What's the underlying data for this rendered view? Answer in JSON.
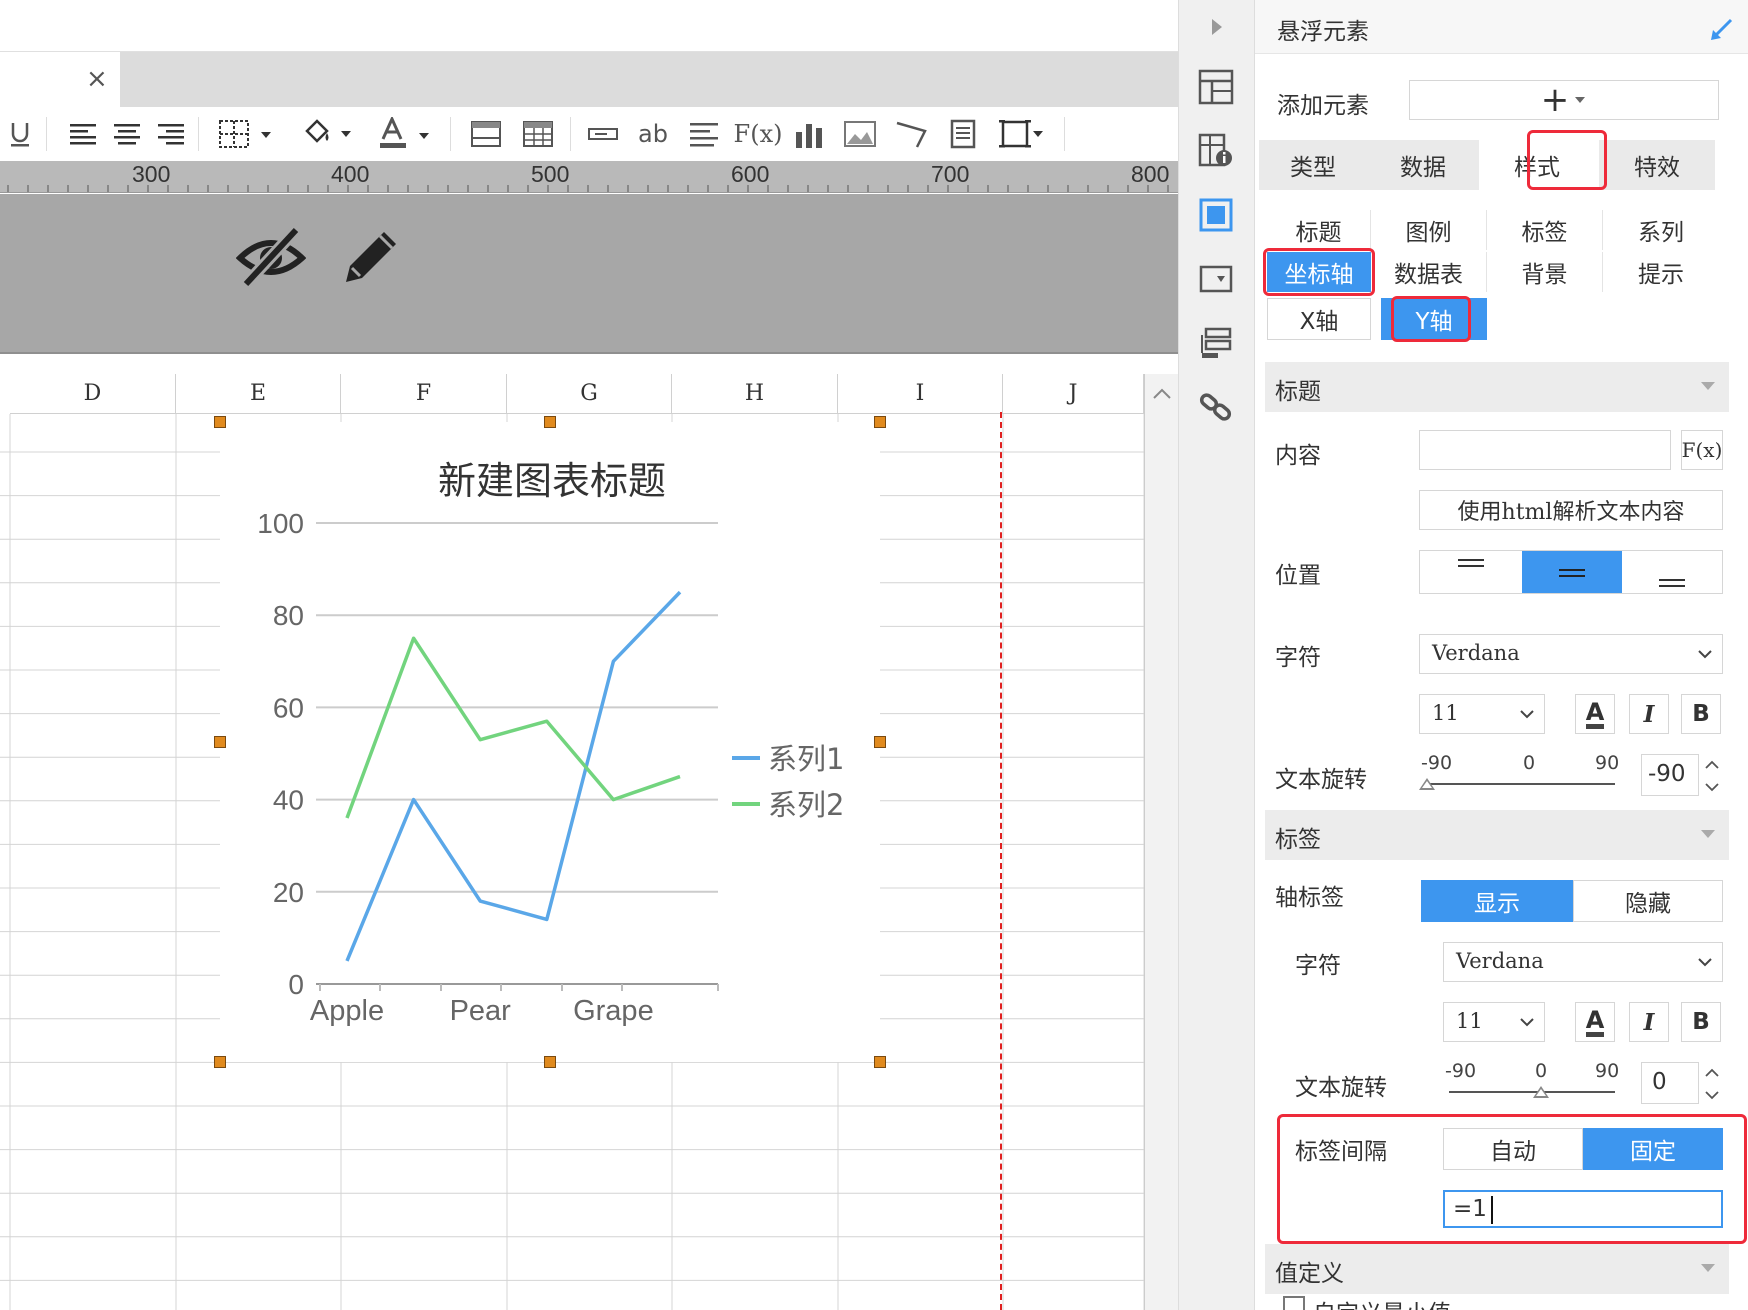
{
  "tab": {
    "close_label": "×"
  },
  "ruler": {
    "labels": [
      "300",
      "400",
      "500",
      "600",
      "700",
      "800"
    ]
  },
  "toolbar": {
    "text_ab": "ab",
    "formula": "F(x)"
  },
  "columns": [
    "D",
    "E",
    "F",
    "G",
    "H",
    "I",
    "J"
  ],
  "chart_data": {
    "type": "line",
    "title": "新建图表标题",
    "categories": [
      "Apple",
      "",
      "Pear",
      "",
      "Grape",
      ""
    ],
    "x_tick_labels": [
      "Apple",
      "Pear",
      "Grape"
    ],
    "series": [
      {
        "name": "系列1",
        "color": "#5aa7e8",
        "values": [
          5,
          40,
          18,
          14,
          70,
          85
        ]
      },
      {
        "name": "系列2",
        "color": "#72d47e",
        "values": [
          36,
          75,
          53,
          57,
          40,
          45
        ]
      }
    ],
    "ylim": [
      0,
      100
    ],
    "y_ticks": [
      0,
      20,
      40,
      60,
      80,
      100
    ],
    "grid": true,
    "legend": "right"
  },
  "panel": {
    "title": "悬浮元素",
    "add_element_label": "添加元素",
    "add_button": "+",
    "top_tabs": [
      "类型",
      "数据",
      "样式",
      "特效"
    ],
    "style_tabs_row1": [
      "标题",
      "图例",
      "标签",
      "系列"
    ],
    "style_tabs_row2": [
      "坐标轴",
      "数据表",
      "背景",
      "提示"
    ],
    "axis_tabs": [
      "X轴",
      "Y轴"
    ],
    "title_section": {
      "header": "标题",
      "content_label": "内容",
      "content_value": "",
      "fx_button": "F(x)",
      "html_button": "使用html解析文本内容",
      "position_label": "位置",
      "font_label": "字符",
      "font_value": "Verdana",
      "size_value": "11",
      "color_button": "A",
      "italic_button": "I",
      "bold_button": "B",
      "rotate_label": "文本旋转",
      "rotate_min": "-90",
      "rotate_mid": "0",
      "rotate_max": "90",
      "rotate_value": "-90"
    },
    "label_section": {
      "header": "标签",
      "axis_label": "轴标签",
      "show_button": "显示",
      "hide_button": "隐藏",
      "font_label": "字符",
      "font_value": "Verdana",
      "size_value": "11",
      "color_button": "A",
      "italic_button": "I",
      "bold_button": "B",
      "rotate_label": "文本旋转",
      "rotate_min": "-90",
      "rotate_mid": "0",
      "rotate_max": "90",
      "rotate_value": "0",
      "interval_label": "标签间隔",
      "auto_button": "自动",
      "fixed_button": "固定",
      "interval_value": "=1"
    },
    "value_section": {
      "header": "值定义",
      "custom_min_label": "自定义最小值"
    }
  },
  "colors": {
    "accent": "#3d96ef",
    "highlight": "#ee2a3a",
    "handle": "#e08a1e"
  }
}
